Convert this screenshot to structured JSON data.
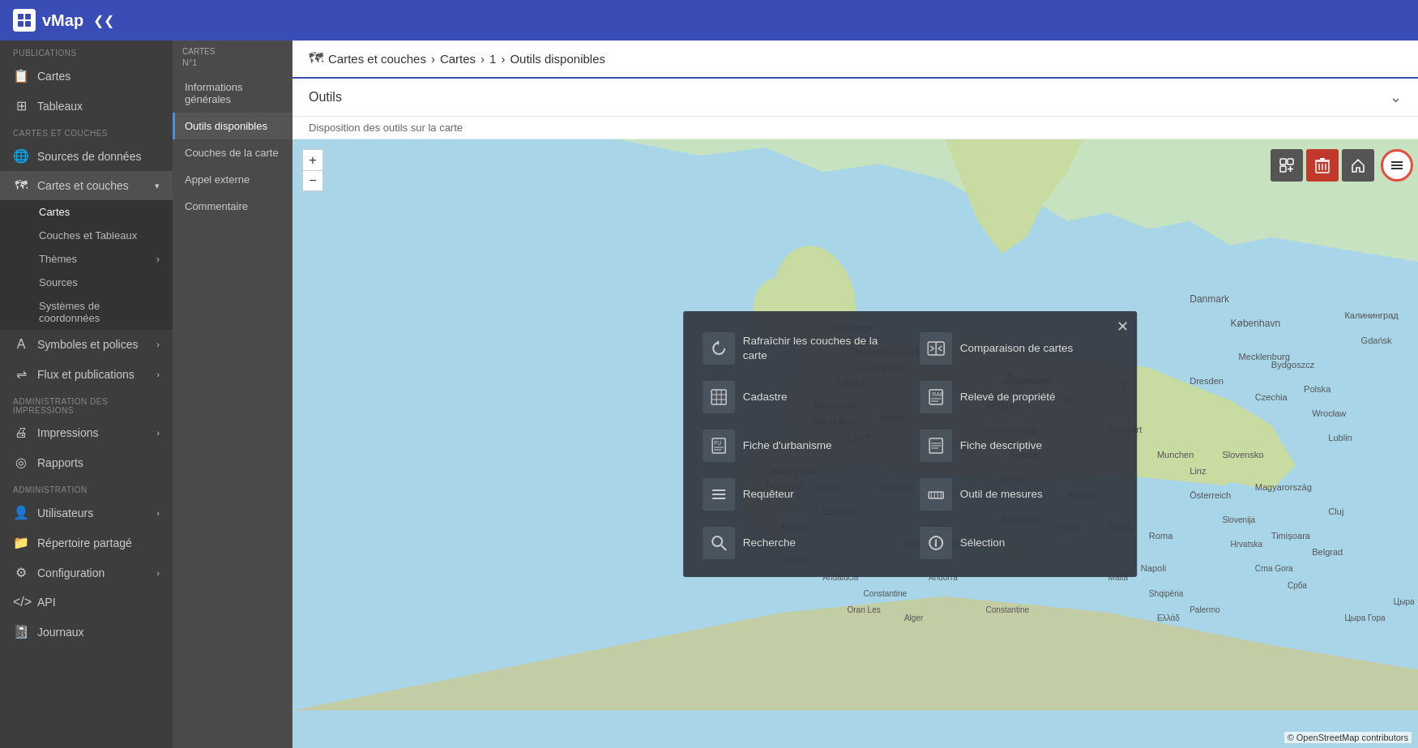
{
  "app": {
    "logo_text": "vMap",
    "collapse_icon": "❮❮"
  },
  "topbar": {
    "title": "vMap"
  },
  "sidebar": {
    "section_publications": "Publications",
    "item_cartes": "Cartes",
    "item_tableaux": "Tableaux",
    "section_cartes_couches": "Cartes et couches",
    "item_sources_donnees": "Sources de données",
    "item_cartes_couches": "Cartes et couches",
    "sub_cartes": "Cartes",
    "sub_couches_tableaux": "Couches et Tableaux",
    "sub_themes": "Thèmes",
    "sub_sources": "Sources",
    "sub_systemes": "Systèmes de coordonnées",
    "item_symboles": "Symboles et polices",
    "item_flux": "Flux et publications",
    "section_impression": "Administration des impressions",
    "item_impressions": "Impressions",
    "item_rapports": "Rapports",
    "section_admin": "Administration",
    "item_utilisateurs": "Utilisateurs",
    "item_repertoire": "Répertoire partagé",
    "item_configuration": "Configuration",
    "item_api": "API",
    "item_journaux": "Journaux"
  },
  "secondary_sidebar": {
    "header": "Cartes",
    "number": "N°1",
    "items": [
      {
        "label": "Informations générales",
        "active": false
      },
      {
        "label": "Outils disponibles",
        "active": true
      },
      {
        "label": "Couches de la carte",
        "active": false
      },
      {
        "label": "Appel externe",
        "active": false
      },
      {
        "label": "Commentaire",
        "active": false
      }
    ]
  },
  "breadcrumb": {
    "icon": "🗺",
    "parts": [
      "Cartes et couches",
      "Cartes",
      "1",
      "Outils disponibles"
    ],
    "separator": ">"
  },
  "panel": {
    "title": "Outils",
    "subtitle": "Disposition des outils sur la carte",
    "collapse_icon": "⌄"
  },
  "map": {
    "zoom_plus": "+",
    "zoom_minus": "−",
    "tool_add_icon": "⊞",
    "tool_delete_icon": "🗑",
    "tool_home_icon": "⌂",
    "tool_layers_icon": "☰",
    "osm_credit": "© OpenStreetMap contributors"
  },
  "tools_overlay": {
    "close_icon": "✕",
    "tools": [
      {
        "id": "rafraichir",
        "label": "Rafraîchir les couches de la carte",
        "icon": "↻"
      },
      {
        "id": "comparaison",
        "label": "Comparaison de cartes",
        "icon": "🗺"
      },
      {
        "id": "cadastre",
        "label": "Cadastre",
        "icon": "📋"
      },
      {
        "id": "releve",
        "label": "Relevé de propriété",
        "icon": "📄"
      },
      {
        "id": "urbanisme",
        "label": "Fiche d'urbanisme",
        "icon": "📝"
      },
      {
        "id": "descriptive",
        "label": "Fiche descriptive",
        "icon": "📄"
      },
      {
        "id": "requeteur",
        "label": "Requêteur",
        "icon": "≡"
      },
      {
        "id": "mesures",
        "label": "Outil de mesures",
        "icon": "📏"
      },
      {
        "id": "recherche",
        "label": "Recherche",
        "icon": "🔍"
      },
      {
        "id": "selection",
        "label": "Sélection",
        "icon": "ℹ"
      }
    ]
  }
}
